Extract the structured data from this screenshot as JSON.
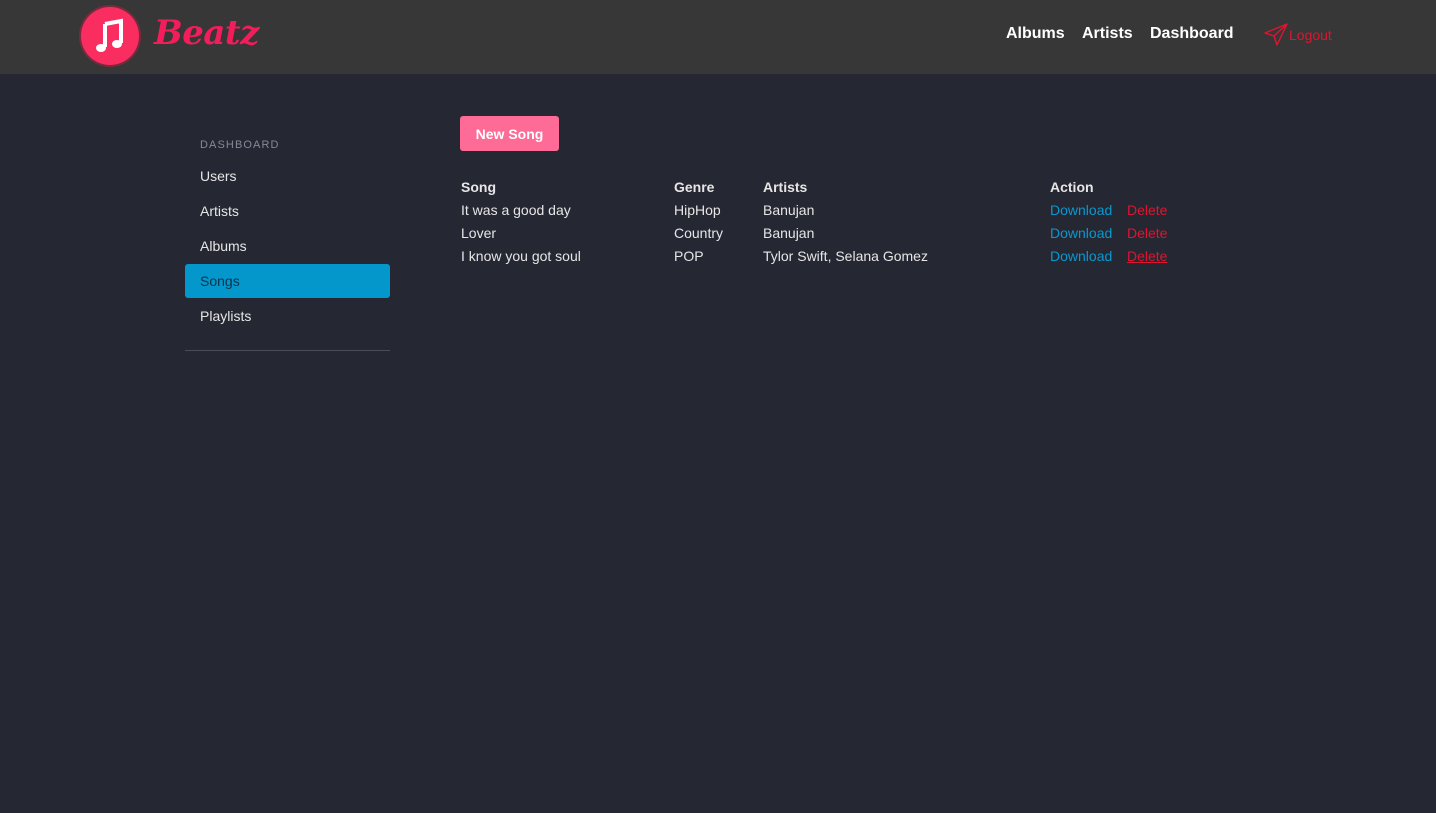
{
  "brand": {
    "name": "Beatz"
  },
  "nav": {
    "albums": "Albums",
    "artists": "Artists",
    "dashboard": "Dashboard",
    "logout": "Logout"
  },
  "sidebar": {
    "header": "DASHBOARD",
    "items": [
      {
        "label": "Users"
      },
      {
        "label": "Artists"
      },
      {
        "label": "Albums"
      },
      {
        "label": "Songs",
        "active": true
      },
      {
        "label": "Playlists"
      }
    ]
  },
  "main": {
    "new_button": "New Song",
    "table": {
      "headers": {
        "song": "Song",
        "genre": "Genre",
        "artists": "Artists",
        "action": "Action"
      },
      "rows": [
        {
          "song": "It was a good day",
          "genre": "HipHop",
          "artists": "Banujan",
          "download": "Download",
          "delete": "Delete"
        },
        {
          "song": "Lover",
          "genre": "Country",
          "artists": "Banujan",
          "download": "Download",
          "delete": "Delete"
        },
        {
          "song": "I know you got soul",
          "genre": "POP",
          "artists": "Tylor Swift, Selana Gomez",
          "download": "Download",
          "delete": "Delete"
        }
      ]
    }
  },
  "colors": {
    "background": "#252733",
    "topbar": "#373737",
    "brand": "#f21d5a",
    "active": "#0397cb",
    "button": "#ff6b97",
    "download": "#0a98cf",
    "delete": "#e0142f"
  },
  "icons": {
    "logo": "music-note-icon",
    "logout": "paper-plane-icon"
  }
}
